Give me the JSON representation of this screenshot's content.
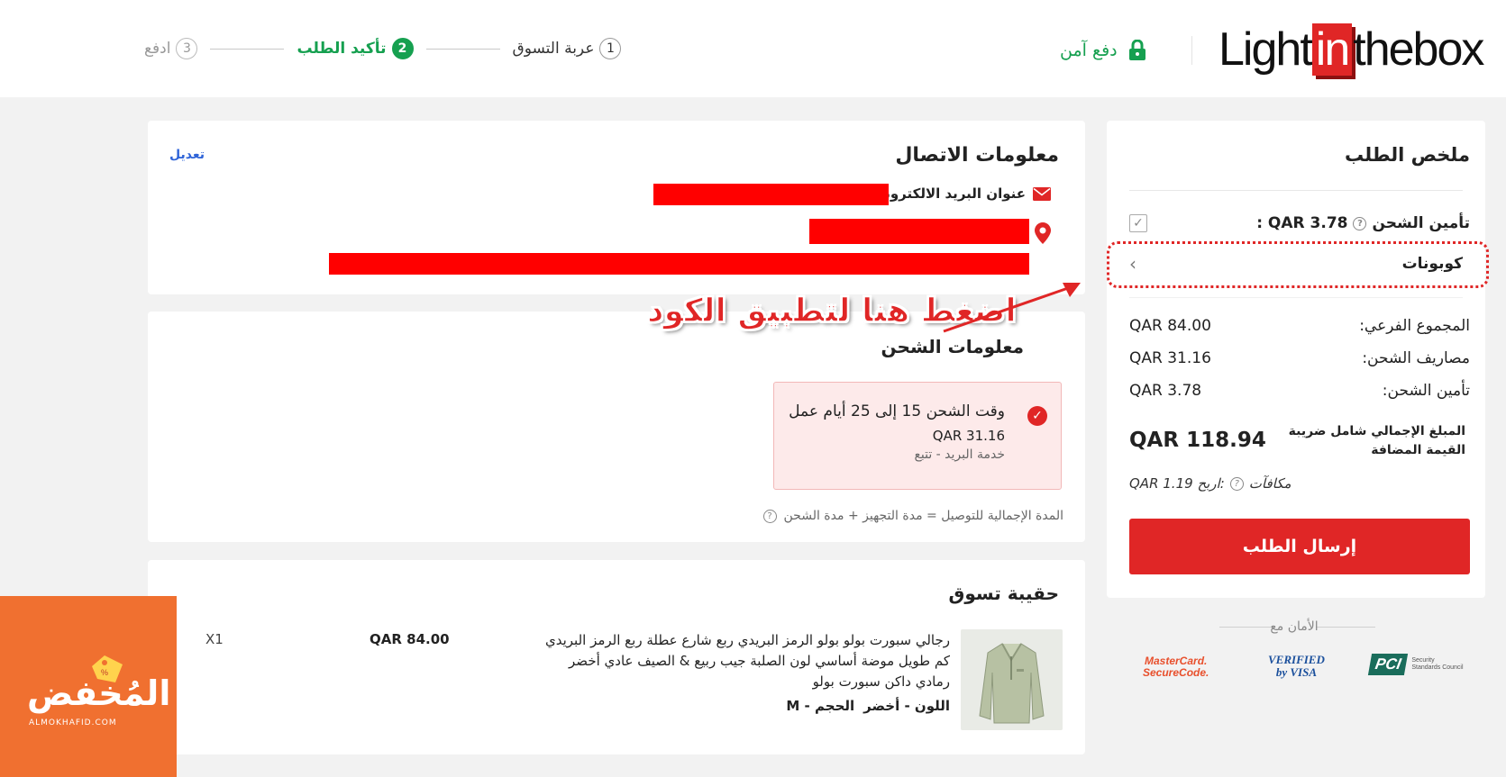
{
  "header": {
    "logo": {
      "before": "Light",
      "box": "in",
      "after": "thebox"
    },
    "secure_label": "دفع آمن",
    "steps": [
      {
        "num": "1",
        "label": "عربة التسوق"
      },
      {
        "num": "2",
        "label": "تأكيد الطلب"
      },
      {
        "num": "3",
        "label": "ادفع"
      }
    ]
  },
  "contact": {
    "title": "معلومات الاتصال",
    "edit": "تعديل",
    "email_label": "عنوان البريد الالكتروني:"
  },
  "shipping": {
    "title": "معلومات الشحن",
    "option_time": "وقت الشحن 15 إلى 25 أيام عمل",
    "option_price": "QAR 31.16",
    "option_service": "خدمة البريد - تتبع",
    "note": "المدة الإجمالية للتوصيل = مدة التجهيز + مدة الشحن"
  },
  "cart": {
    "title": "حقيبة تسوق",
    "product_desc": "رجالي سبورت بولو بولو الرمز البريدي ربع شارع عطلة ربع الرمز البريدي كم طويل موضة أساسي لون الصلبة جيب ربيع & الصيف عادي أخضر رمادي داكن سبورت بولو",
    "color_label": "اللون - أخضر",
    "size_label": "الحجم - M",
    "price": "QAR 84.00",
    "qty": "X1"
  },
  "summary": {
    "title": "ملخص الطلب",
    "insurance_label": "تأمين الشحن",
    "insurance_value": ": QAR 3.78",
    "coupons": "كوبونات",
    "subtotal_label": "المجموع الفرعي:",
    "subtotal": "QAR 84.00",
    "shipping_label": "مصاريف الشحن:",
    "shipping": "QAR 31.16",
    "insurance_label2": "تأمين الشحن:",
    "insurance": "QAR 3.78",
    "total_label": "المبلغ الإجمالي شامل ضريبة القيمة المضافة",
    "total": "QAR 118.94",
    "rewards_label": "مكافآت",
    "rewards_value": ":اربح QAR 1.19",
    "submit": "إرسال الطلب"
  },
  "security": {
    "title": "الأمان مع",
    "mastercard": [
      "MasterCard.",
      "SecureCode."
    ],
    "visa": [
      "VERIFIED",
      "by VISA"
    ],
    "pci": "PCI",
    "pci_text": [
      "Security",
      "Standards Council"
    ]
  },
  "annotation": "اضغط هنا لتطبيق الكود",
  "watermark": {
    "brand": "المُخفض",
    "url": "ALMOKHAFID.COM"
  },
  "colors": {
    "accent": "#e02626",
    "green": "#16a050",
    "watermark": "#f07030"
  }
}
